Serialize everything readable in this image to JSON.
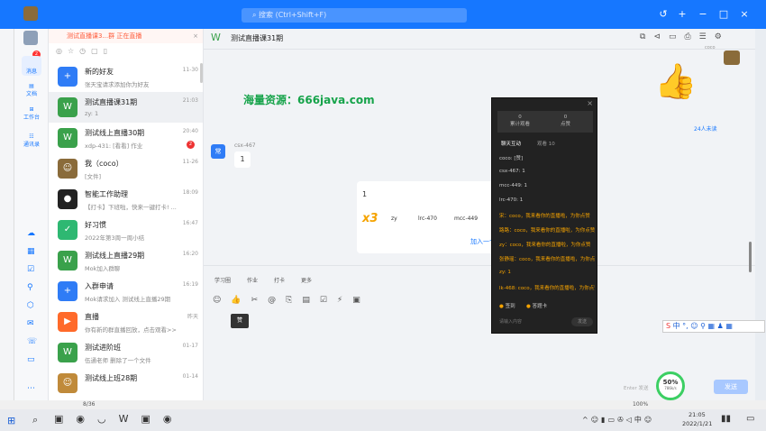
{
  "app": {
    "search_placeholder": "搜索 (Ctrl+Shift+F)",
    "live_banner": "测试直播课3...群 正在直播"
  },
  "nav": {
    "messages": "消息",
    "docs": "文档",
    "workbench": "工作台",
    "contacts": "通讯录",
    "badge": "2"
  },
  "conversations": [
    {
      "name": "新的好友",
      "preview": "张天宝请求添加你为好友",
      "time": "11-30",
      "color": "#2f7cf6",
      "glyph": "+",
      "sel": false
    },
    {
      "name": "测试直播课31期",
      "preview": "zy: 1",
      "time": "21:03",
      "color": "#3aa14b",
      "glyph": "W",
      "sel": true
    },
    {
      "name": "测试线上直播30期",
      "preview": "xdp-431: [看看] 作业",
      "time": "20:40",
      "color": "#3aa14b",
      "glyph": "W",
      "sel": false,
      "badge": "2"
    },
    {
      "name": "我（coco）",
      "preview": "[文件]",
      "time": "11-26",
      "color": "#8a6b3a",
      "glyph": "☺",
      "sel": false
    },
    {
      "name": "智能工作助理",
      "preview": "【打卡】下班啦，快来一键打卡! ...",
      "time": "18:09",
      "color": "#222",
      "glyph": "●",
      "sel": false
    },
    {
      "name": "好习惯",
      "preview": "2022年第3周一周小结",
      "time": "16:47",
      "color": "#2eb872",
      "glyph": "✓",
      "sel": false
    },
    {
      "name": "测试线上直播29期",
      "preview": "Mok加入群聊",
      "time": "16:20",
      "color": "#3aa14b",
      "glyph": "W",
      "sel": false
    },
    {
      "name": "入群申请",
      "preview": "Mok请求加入 测试线上直播29期",
      "time": "16:19",
      "color": "#2f7cf6",
      "glyph": "+",
      "sel": false
    },
    {
      "name": "直播",
      "preview": "你有新的群直播回放，点击观看>>",
      "time": "昨天",
      "color": "#ff6a2a",
      "glyph": "▶",
      "sel": false
    },
    {
      "name": "测试进阶班",
      "preview": "伍通老师 删除了一个文件",
      "time": "01-17",
      "color": "#3aa14b",
      "glyph": "W",
      "sel": false
    },
    {
      "name": "测试线上班28期",
      "preview": "",
      "time": "01-14",
      "color": "#c08a3a",
      "glyph": "☺",
      "sel": false
    }
  ],
  "chat": {
    "title": "测试直播课31期",
    "watermark": "海量资源：666java.com",
    "sender": "csx-467",
    "msg": "1",
    "msg2": "1",
    "count": "3",
    "names": [
      "zy",
      "lrc-470",
      "mcc-449"
    ],
    "join": "加入一个",
    "viewers": "24人未读",
    "coco": "coco",
    "tools": [
      "学习圈",
      "作业",
      "打卡",
      "更多"
    ],
    "send": "发送",
    "enter_hint": "Enter 发送",
    "tip": "赞"
  },
  "overlay": {
    "stat1": "0",
    "stat1_label": "累计观看",
    "stat2": "0",
    "stat2_label": "点赞",
    "tab1": "聊天互动",
    "tab2": "观看 10",
    "lines": [
      "coco: [赞]",
      "csx-467: 1",
      "mcc-449: 1",
      "lrc-470: 1",
      "宋：coco，我来看你的直播啦，为你点赞",
      "路路：coco，我来看你的直播啦，为你点赞",
      "zy：coco，我来看你的直播啦，为你点赞",
      "张静瑶：coco，我来看你的直播啦，为你点赞",
      "zy: 1",
      "lk-468: coco，我来看你的直播啦，为你点赞"
    ],
    "opt1": "签到",
    "opt2": "答题卡",
    "input_ph": "请输入内容",
    "send": "发送"
  },
  "progress": {
    "pct": "50%",
    "speed": "786k/s"
  },
  "status": {
    "page": "8/36",
    "zoom": "100%"
  },
  "taskbar": {
    "time": "21:05",
    "date": "2022/1/21"
  }
}
